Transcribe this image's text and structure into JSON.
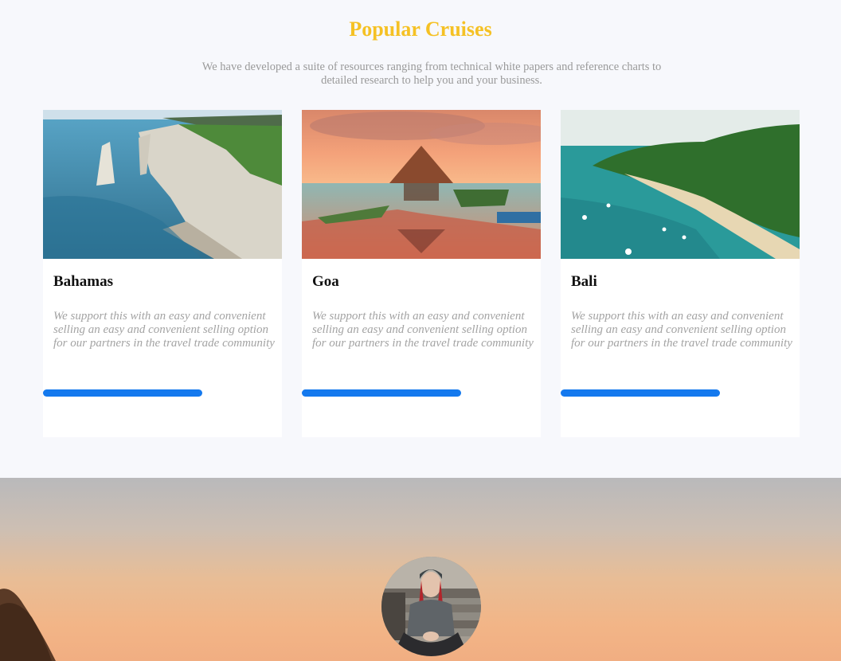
{
  "section": {
    "title": "Popular Cruises",
    "subtitle": "We have developed a suite of resources ranging from technical white papers and reference charts to detailed research to help you and your business."
  },
  "cards": [
    {
      "title": "Bahamas",
      "description": "We support this with an easy and convenient selling an easy and convenient selling option for our partners in the travel trade community",
      "image": "coastal-cliffs-photo"
    },
    {
      "title": "Goa",
      "description": "We support this with an easy and convenient selling an easy and convenient selling option for our partners in the travel trade community",
      "image": "sunset-pavilion-pool-photo"
    },
    {
      "title": "Bali",
      "description": "We support this with an easy and convenient selling an easy and convenient selling option for our partners in the travel trade community",
      "image": "tropical-bay-photo"
    }
  ],
  "colors": {
    "accent_title": "#f5c124",
    "button": "#1479ee"
  },
  "testimonial": {
    "avatar": "person-avatar-photo"
  }
}
